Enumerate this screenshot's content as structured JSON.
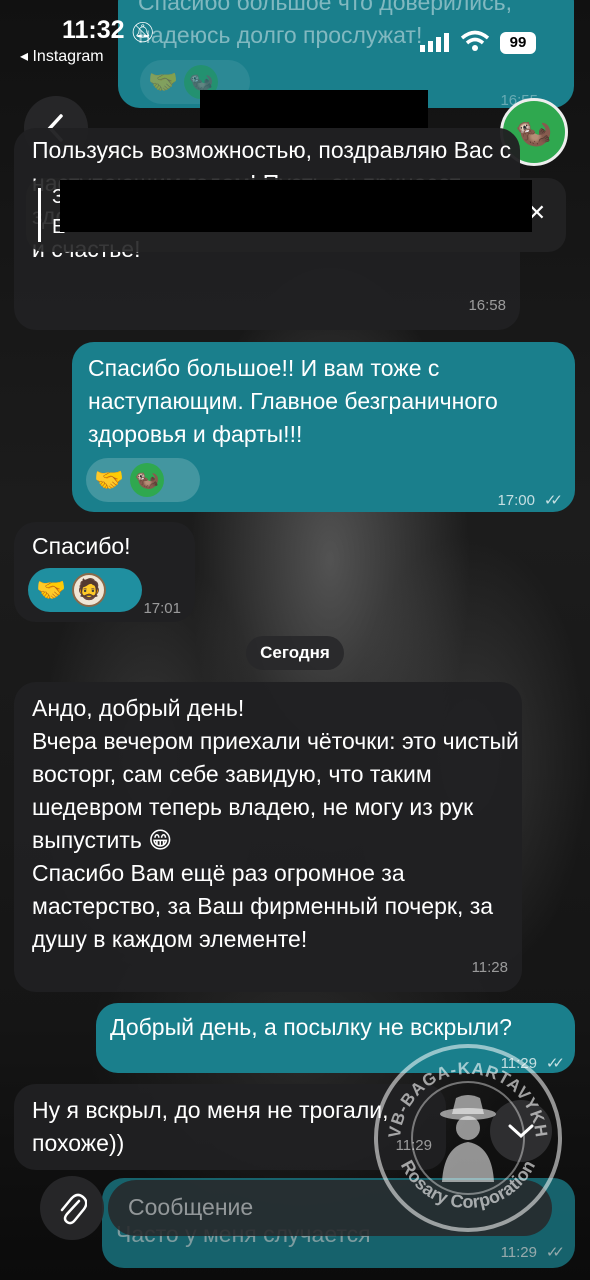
{
  "status_bar": {
    "time": "11:32",
    "back_app": "◂ Instagram",
    "battery": "99"
  },
  "header": {
    "title": "",
    "avatar_icon": "otter-emoji-avatar"
  },
  "pinned": {
    "line1": "З",
    "line2": "Е"
  },
  "messages": [
    {
      "id": "m0",
      "dir": "out",
      "text": "Спасибо большое что доверились, надеюсь долго прослужат!",
      "time": "16:55"
    },
    {
      "id": "m1",
      "dir": "in",
      "text": "Пользуясь возможностью, поздравляю Вас с наступающим годом! Пусть он принесет здоровье, успехи, реализацию задуманного и счастье!",
      "time": "16:58"
    },
    {
      "id": "m2",
      "dir": "out",
      "text": "Спасибо большое!! И вам тоже с наступающим. Главное безграничного здоровья и фарты!!!",
      "time": "17:00"
    },
    {
      "id": "m3",
      "dir": "in",
      "text": "Спасибо!",
      "time": "17:01"
    },
    {
      "id": "m4",
      "dir": "in",
      "text": "Андо, добрый день!\nВчера вечером приехали чёточки: это чистый восторг, сам себе завидую, что таким шедевром теперь владею, не могу из рук выпустить 😁\nСпасибо Вам ещё раз огромное за мастерство, за Ваш фирменный почерк, за душу в каждом элементе!",
      "time": "11:28"
    },
    {
      "id": "m5",
      "dir": "out",
      "text": "Добрый день, а посылку не вскрыли?",
      "time": "11:29"
    },
    {
      "id": "m6",
      "dir": "in",
      "text": "Ну я вскрыл, до меня не трогали, похоже))",
      "time": "11:29"
    },
    {
      "id": "m7",
      "dir": "out",
      "text": "Часто у меня случается",
      "time": "11:29"
    }
  ],
  "date_separator": "Сегодня",
  "composer": {
    "placeholder": "Сообщение"
  },
  "watermark": {
    "top": "VB-BAGA-KARTAVYKH",
    "bottom": "Rosary Corporation"
  },
  "colors": {
    "outgoing": "#1a7f8c",
    "incoming": "#202022",
    "accent": "#2fa84f"
  }
}
